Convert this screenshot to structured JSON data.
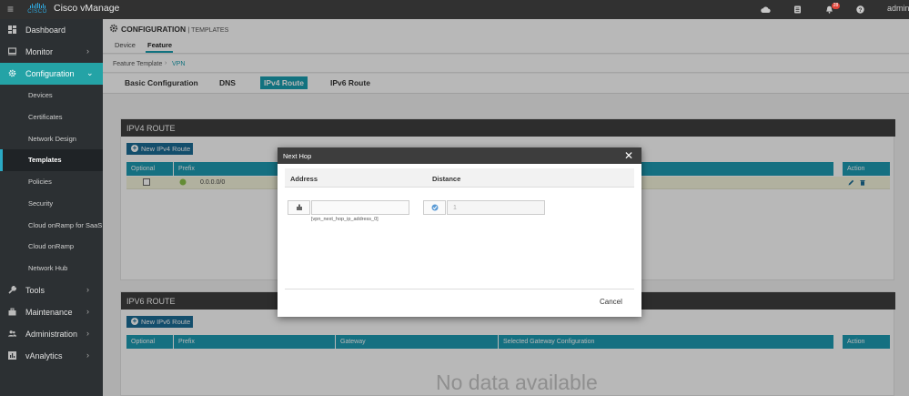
{
  "app": {
    "menu_icon": "hamburger-icon",
    "logo_text": "CISCO",
    "title": "Cisco vManage",
    "user": "admin",
    "notification_count": "28",
    "icons": [
      "cloud-icon",
      "tasks-icon",
      "bell-icon",
      "help-icon"
    ]
  },
  "sidebar": {
    "items": [
      {
        "label": "Dashboard",
        "icon": "dashboard-icon"
      },
      {
        "label": "Monitor",
        "icon": "monitor-icon"
      },
      {
        "label": "Configuration",
        "icon": "gear-icon"
      },
      {
        "label": "Tools",
        "icon": "wrench-icon"
      },
      {
        "label": "Maintenance",
        "icon": "toolbox-icon"
      },
      {
        "label": "Administration",
        "icon": "users-icon"
      },
      {
        "label": "vAnalytics",
        "icon": "analytics-icon"
      }
    ],
    "sub_items": [
      {
        "label": "Devices"
      },
      {
        "label": "Certificates"
      },
      {
        "label": "Network Design"
      },
      {
        "label": "Templates"
      },
      {
        "label": "Policies"
      },
      {
        "label": "Security"
      },
      {
        "label": "Cloud onRamp for SaaS"
      },
      {
        "label": "Cloud onRamp"
      },
      {
        "label": "Network Hub"
      }
    ]
  },
  "header": {
    "title": "CONFIGURATION",
    "subtitle": "| TEMPLATES",
    "tabs": [
      {
        "label": "Device"
      },
      {
        "label": "Feature"
      }
    ]
  },
  "breadcrumb": {
    "parent": "Feature Template",
    "separator": "›",
    "current": "VPN"
  },
  "subtabs": [
    {
      "label": "Basic Configuration"
    },
    {
      "label": "DNS"
    },
    {
      "label": "IPv4 Route"
    },
    {
      "label": "IPv6 Route"
    }
  ],
  "ipv4": {
    "title": "IPV4 ROUTE",
    "new_button": "New IPv4 Route",
    "columns": [
      "Optional",
      "Prefix"
    ],
    "action_col": "Action",
    "row": {
      "prefix": "0.0.0.0/0"
    }
  },
  "ipv6": {
    "title": "IPV6 ROUTE",
    "new_button": "New IPv6 Route",
    "columns": [
      "Optional",
      "Prefix",
      "Gateway",
      "Selected Gateway Configuration"
    ],
    "action_col": "Action",
    "no_data": "No data available"
  },
  "modal": {
    "title": "Next Hop",
    "close_icon": "close-icon",
    "col_address": "Address",
    "col_distance": "Distance",
    "address_value": "",
    "address_hint": "[vpn_next_hop_ip_address_0]",
    "distance_value": "1",
    "cancel": "Cancel"
  }
}
